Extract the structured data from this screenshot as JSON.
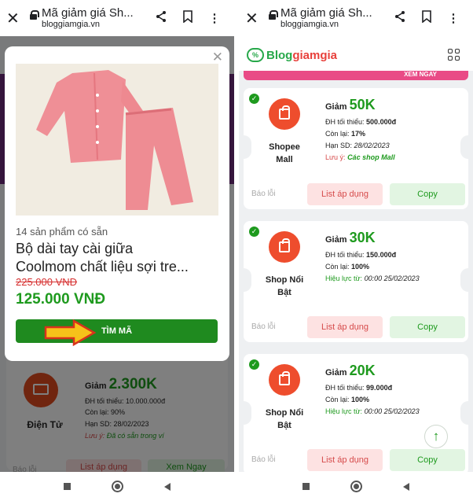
{
  "left_screen": {
    "browser": {
      "close_glyph": "✕",
      "title": "Mã giảm giá Sh...",
      "url": "bloggiamgia.vn",
      "share_glyph": "⋖",
      "bookmark_glyph": "▢",
      "menu_glyph": "⋮"
    },
    "background_card": {
      "icon": "monitor-icon",
      "shop_label": "Điện Tử",
      "giam_label": "Giảm",
      "giam_value": "2.300K",
      "min_order": "ĐH tối thiểu: 10.000.000đ",
      "remaining": "Còn lại: 90%",
      "expiry": "Hạn SD: 28/02/2023",
      "note_label": "Lưu ý:",
      "note_value": "Đã có sẵn trong ví",
      "report": "Báo lỗi",
      "list_btn": "List áp dụng",
      "view_btn": "Xem Ngay"
    },
    "modal": {
      "close_glyph": "✕",
      "product_count": "14 sản phẩm có sẵn",
      "product_name": "Bộ dài tay cài giữa\nCoolmom chất liệu sợi tre...",
      "old_price": "225.000 VNĐ",
      "new_price": "125.000 VNĐ",
      "cta_button": "TÌM MÃ",
      "image_icon": "pink-pajama-set-image"
    }
  },
  "right_screen": {
    "browser": {
      "close_glyph": "✕",
      "title": "Mã giảm giá Sh...",
      "url": "bloggiamgia.vn",
      "share_glyph": "⋖",
      "bookmark_glyph": "▢",
      "menu_glyph": "⋮"
    },
    "logo_badge": "%",
    "logo_part1": "Blog",
    "logo_part2": "giamgia",
    "banner_text": "XEM NGAY",
    "cards": [
      {
        "shop_label": "Shopee\nMall",
        "giam_label": "Giảm",
        "giam_value": "50K",
        "min_order_label": "ĐH tối thiểu:",
        "min_order_value": "500.000đ",
        "remaining_label": "Còn lại:",
        "remaining_value": "17%",
        "extra_label": "Hạn SD:",
        "extra_value": "28/02/2023",
        "note_label": "Lưu ý:",
        "note_value": "Các shop Mall",
        "report": "Báo lỗi",
        "list_btn": "List áp dụng",
        "copy_btn": "Copy"
      },
      {
        "shop_label": "Shop Nổi\nBật",
        "giam_label": "Giảm",
        "giam_value": "30K",
        "min_order_label": "ĐH tối thiểu:",
        "min_order_value": "150.000đ",
        "remaining_label": "Còn lại:",
        "remaining_value": "100%",
        "extra_label": "Hiệu lực từ:",
        "extra_value": "00:00 25/02/2023",
        "report": "Báo lỗi",
        "list_btn": "List áp dụng",
        "copy_btn": "Copy"
      },
      {
        "shop_label": "Shop Nổi\nBật",
        "giam_label": "Giảm",
        "giam_value": "20K",
        "min_order_label": "ĐH tối thiểu:",
        "min_order_value": "99.000đ",
        "remaining_label": "Còn lại:",
        "remaining_value": "100%",
        "extra_label": "Hiệu lực từ:",
        "extra_value": "00:00 25/02/2023",
        "report": "Báo lỗi",
        "list_btn": "List áp dụng",
        "copy_btn": "Copy"
      }
    ],
    "scroll_top_glyph": "↑"
  },
  "colors": {
    "accent_green": "#1e9a1e",
    "shopee_orange": "#ee4d2d",
    "price_red": "#d62f2f",
    "list_pink": "#fde2e2"
  }
}
